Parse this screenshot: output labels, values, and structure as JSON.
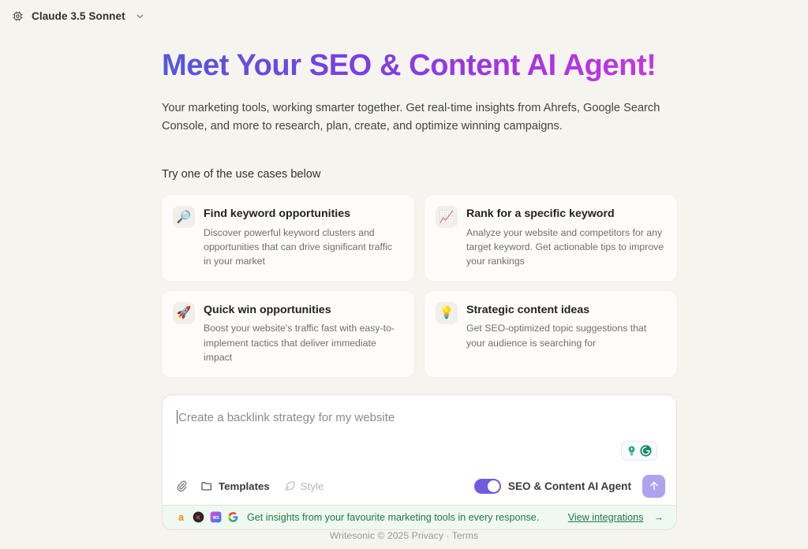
{
  "topbar": {
    "model_icon": "chip-icon",
    "model_name": "Claude 3.5 Sonnet",
    "chevron": "chevron-down-icon"
  },
  "hero": {
    "title": "Meet Your SEO & Content AI Agent!",
    "subtitle": "Your marketing tools, working smarter together. Get real-time insights from Ahrefs, Google Search Console, and more to research, plan, create, and optimize winning campaigns.",
    "gradient_start": "#5558D9",
    "gradient_end": "#C63AE0"
  },
  "use_cases": {
    "label": "Try one of the use cases below",
    "cards": [
      {
        "icon": "magnifier-icon",
        "glyph": "🔎",
        "title": "Find keyword opportunities",
        "desc": "Discover powerful keyword clusters and opportunities that can drive significant traffic in your market"
      },
      {
        "icon": "chart-up-icon",
        "glyph": "📈",
        "title": "Rank for a specific keyword",
        "desc": "Analyze your website and competitors for any target keyword. Get actionable tips to improve your rankings"
      },
      {
        "icon": "rocket-icon",
        "glyph": "🚀",
        "title": "Quick win opportunities",
        "desc": "Boost your website's traffic fast with easy-to-implement tactics that deliver immediate impact"
      },
      {
        "icon": "lightbulb-icon",
        "glyph": "💡",
        "title": "Strategic content ideas",
        "desc": "Get SEO-optimized topic suggestions that your audience is searching for"
      }
    ]
  },
  "composer": {
    "placeholder": "Create a backlink strategy for my website",
    "grammarly": {
      "bulb_icon": "grammarly-suggestion-icon",
      "g_icon": "grammarly-logo-icon"
    },
    "attach_icon": "paperclip-icon",
    "templates_icon": "folder-icon",
    "templates_label": "Templates",
    "style_icon": "feather-icon",
    "style_label": "Style",
    "agent_toggle_on": true,
    "agent_label": "SEO & Content AI Agent",
    "send_icon": "arrow-up-icon",
    "toggle_color": "#6E5BE0",
    "send_color": "#AFA3EE"
  },
  "integrations": {
    "logos": [
      "ahrefs-logo",
      "klaviyo-logo",
      "wordpress-logo",
      "google-logo"
    ],
    "text": "Get insights from your favourite marketing tools in every response.",
    "link": "View integrations",
    "arrow": "→",
    "accent": "#1E7A43",
    "background": "#EFF8F1"
  },
  "footer": {
    "brand": "Writesonic © 2025",
    "privacy": "Privacy",
    "separator": "·",
    "terms": "Terms"
  }
}
